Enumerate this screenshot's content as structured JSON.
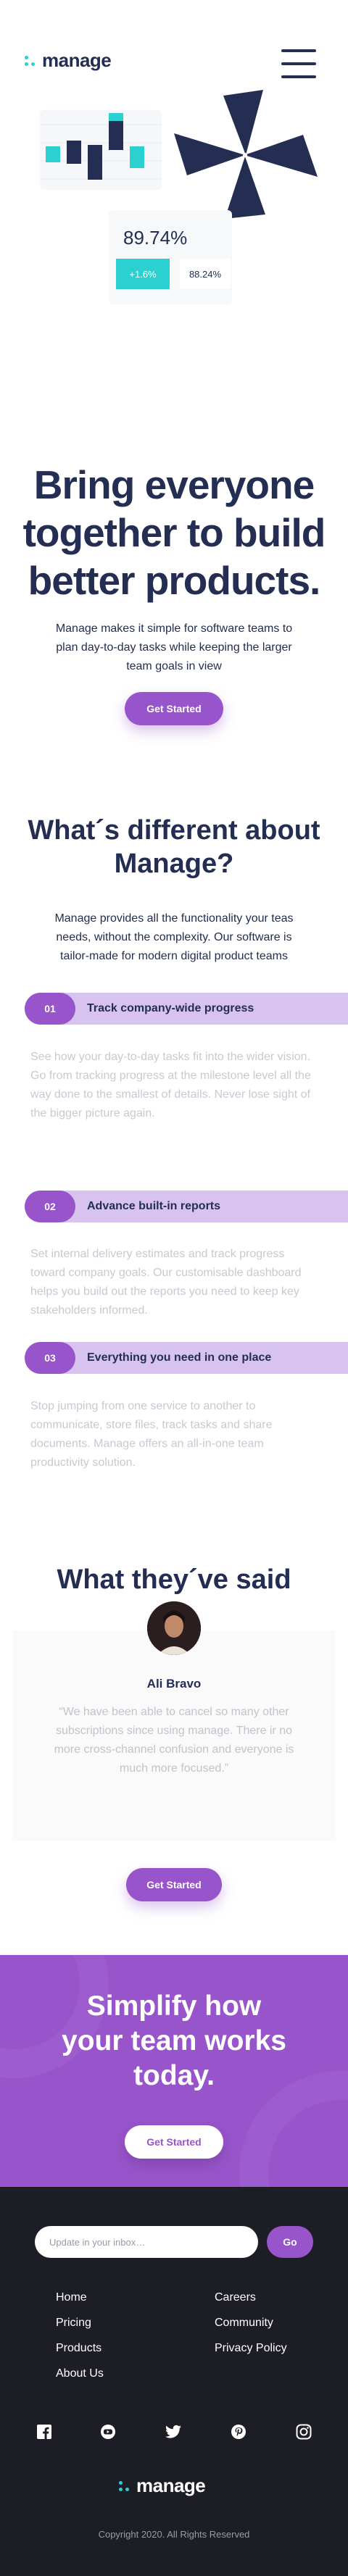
{
  "brand": {
    "logo_text": "manage"
  },
  "illustration": {
    "percentage": "89.74%",
    "stat_up": "+1.6%",
    "stat_other": "88.24%",
    "colors": {
      "navy": "#242D52",
      "teal": "#2BD0D0"
    }
  },
  "hero": {
    "title_lines": [
      "Bring everyone",
      "together to build",
      "better products."
    ],
    "description": "Manage makes it simple for software teams to plan day-to-day tasks while keeping the larger team goals in view",
    "cta_label": "Get Started"
  },
  "features": {
    "title_lines": [
      "What´s different about",
      "Manage?"
    ],
    "description": "Manage provides all the functionality your teas needs, without the complexity. Our software is tailor-made for modern digital product teams",
    "items": [
      {
        "number": "01",
        "title": "Track company-wide progress",
        "text": "See how your day-to-day tasks fit into the wider vision. Go from tracking progress at the milestone level all the way done to the smallest of details. Never lose sight of the bigger picture again."
      },
      {
        "number": "02",
        "title": "Advance built-in reports",
        "text": "Set internal delivery estimates and track progress toward company goals. Our customisable dashboard helps you build out the reports you need to keep key stakeholders informed."
      },
      {
        "number": "03",
        "title": "Everything you need in one place",
        "text": "Stop jumping from one service to another to communicate, store files, track tasks and share documents. Manage offers an all-in-one team productivity solution."
      }
    ]
  },
  "testimonials": {
    "title": "What they´ve said",
    "name": "Ali Bravo",
    "quote": "“We have been able to cancel so many other subscriptions since using manage. There ir no more cross-channel confusion and everyone is much more focused.”",
    "cta_label": "Get Started"
  },
  "cta": {
    "title_lines": [
      "Simplify how",
      "your team works",
      "today."
    ],
    "button_label": "Get Started"
  },
  "footer": {
    "newsletter_placeholder": "Update in your inbox…",
    "go_label": "Go",
    "links_left": [
      "Home",
      "Pricing",
      "Products",
      "About Us"
    ],
    "links_right": [
      "Careers",
      "Community",
      "Privacy Policy"
    ],
    "social_icons": [
      "facebook-icon",
      "youtube-icon",
      "twitter-icon",
      "pinterest-icon",
      "instagram-icon"
    ],
    "logo_text": "manage",
    "copyright": "Copyright 2020. All Rights Reserved"
  },
  "colors": {
    "primary": "#9854CB",
    "primary_light": "#D7C3EE",
    "navy": "#242D52",
    "teal": "#2BD0D0",
    "footer_bg": "#1D1E25"
  }
}
